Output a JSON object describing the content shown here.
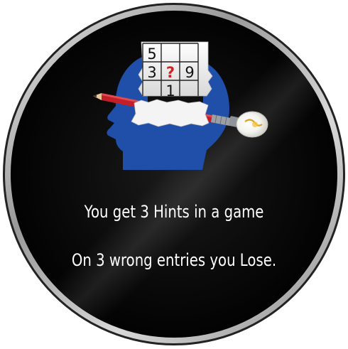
{
  "rules": {
    "line1": "You get 3 Hints in a game",
    "line2": "On 3 wrong entries you Lose."
  },
  "puzzle": {
    "grid_values": [
      "5",
      "",
      "",
      "3",
      "?",
      "9",
      "",
      "1",
      ""
    ]
  },
  "icons": {
    "illustration": "head-pencil-sudoku-icon",
    "bulb": "lightbulb-icon"
  },
  "colors": {
    "background": "#000000",
    "ring": "#b9b9b9",
    "head": "#1f4fa8",
    "pencil": "#c21f28",
    "question_mark": "#d42020",
    "text": "#ffffff"
  }
}
